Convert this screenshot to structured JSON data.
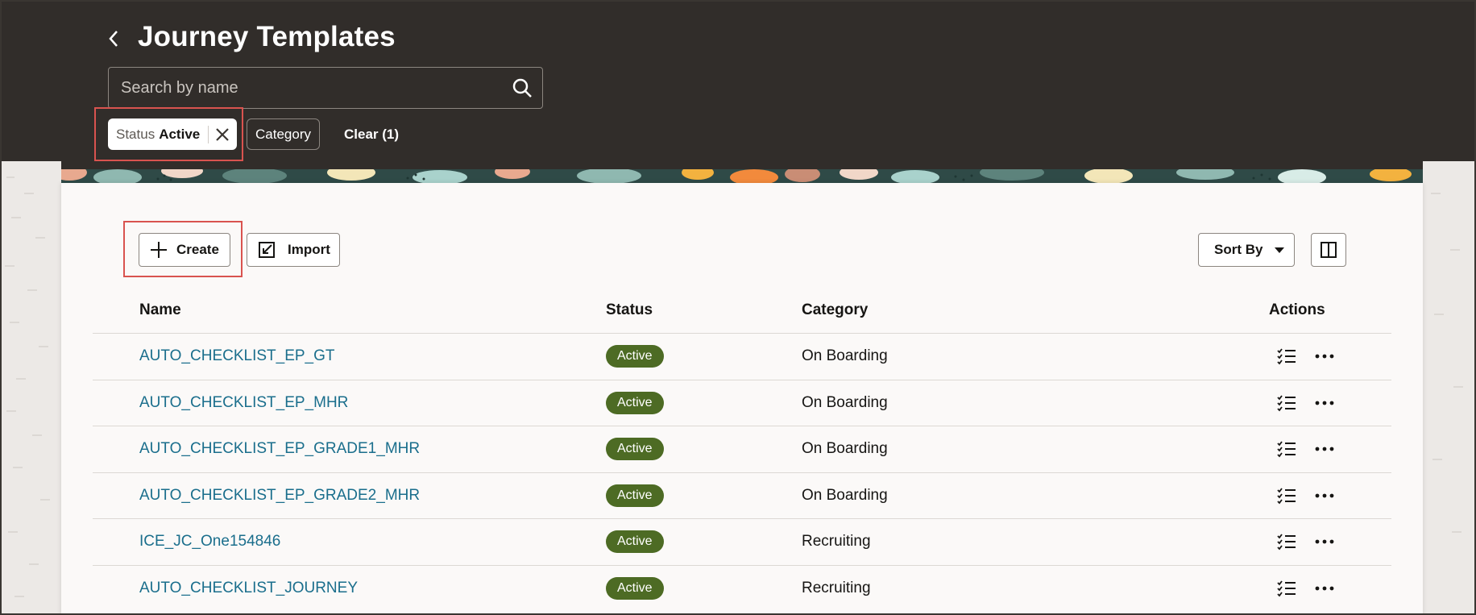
{
  "header": {
    "title": "Journey Templates",
    "search_placeholder": "Search by name"
  },
  "filters": {
    "status_key": "Status",
    "status_value": "Active",
    "category_label": "Category",
    "clear_label": "Clear (1)"
  },
  "toolbar": {
    "create_label": "Create",
    "import_label": "Import",
    "sort_label": "Sort By"
  },
  "table": {
    "columns": [
      "Name",
      "Status",
      "Category",
      "Actions"
    ],
    "rows": [
      {
        "name": "AUTO_CHECKLIST_EP_GT",
        "status": "Active",
        "category": "On Boarding"
      },
      {
        "name": "AUTO_CHECKLIST_EP_MHR",
        "status": "Active",
        "category": "On Boarding"
      },
      {
        "name": "AUTO_CHECKLIST_EP_GRADE1_MHR",
        "status": "Active",
        "category": "On Boarding"
      },
      {
        "name": "AUTO_CHECKLIST_EP_GRADE2_MHR",
        "status": "Active",
        "category": "On Boarding"
      },
      {
        "name": "ICE_JC_One154846",
        "status": "Active",
        "category": "Recruiting"
      },
      {
        "name": "AUTO_CHECKLIST_JOURNEY",
        "status": "Active",
        "category": "Recruiting"
      }
    ]
  },
  "colors": {
    "header_bg": "#312d2a",
    "link": "#1a6e8c",
    "active_badge": "#4d6b24",
    "highlight": "#d9534f"
  }
}
